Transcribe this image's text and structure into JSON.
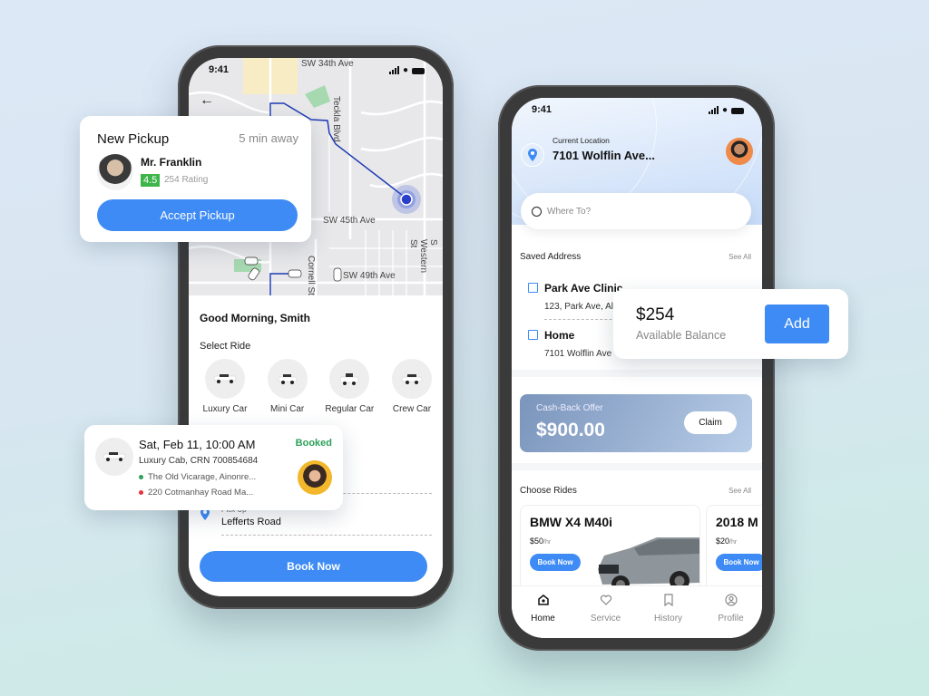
{
  "phone1": {
    "status": {
      "time": "9:41"
    },
    "map": {
      "streets": [
        "SW 34th Ave",
        "Teckla Blvd",
        "SW 45th Ave",
        "Cornell St",
        "SW 49th Ave",
        "S Western St"
      ],
      "back_icon": "arrow-left-icon"
    },
    "greeting": "Good Morning, Smith",
    "select_ride_label": "Select Ride",
    "rides": [
      {
        "label": "Luxury Car",
        "icon": "car-icon"
      },
      {
        "label": "Mini Car",
        "icon": "car-icon"
      },
      {
        "label": "Regular Car",
        "icon": "car-icon"
      },
      {
        "label": "Crew Car",
        "icon": "car-icon"
      }
    ],
    "pickup": {
      "label": "Pick Up",
      "value": "Lefferts Road"
    },
    "book_now_label": "Book Now"
  },
  "pickup_card": {
    "title": "New Pickup",
    "eta": "5 min away",
    "name": "Mr. Franklin",
    "rating": "4.5",
    "rating_count": "254 Rating",
    "accept_label": "Accept Pickup"
  },
  "booking_card": {
    "datetime": "Sat, Feb 11, 10:00 AM",
    "cab": "Luxury Cab, CRN 700854684",
    "from": "The Old Vicarage, Ainonre...",
    "to": "220 Cotmanhay Road Ma...",
    "status": "Booked",
    "colors": {
      "from_dot": "#2ea05a",
      "to_dot": "#e8333a",
      "status": "#2ea05a"
    }
  },
  "phone2": {
    "status": {
      "time": "9:41"
    },
    "current_location_label": "Current Location",
    "current_location": "7101 Wolflin Ave...",
    "search_placeholder": "Where To?",
    "saved_address_title": "Saved Address",
    "see_all": "See All",
    "addresses": [
      {
        "name": "Park Ave Clinic",
        "address": "123, Park Ave, Al"
      },
      {
        "name": "Home",
        "address": "7101 Wolflin Ave"
      }
    ],
    "cashback": {
      "label": "Cash-Back Offer",
      "amount": "$900.00",
      "claim_label": "Claim"
    },
    "choose_rides_title": "Choose Rides",
    "cars": [
      {
        "name": "BMW X4 M40i",
        "price": "$50",
        "unit": "/hr",
        "book_label": "Book Now"
      },
      {
        "name": "2018 M",
        "price": "$20",
        "unit": "/hr",
        "book_label": "Book Now"
      }
    ],
    "tabs": [
      {
        "label": "Home",
        "icon": "home-icon",
        "active": true
      },
      {
        "label": "Service",
        "icon": "heart-icon",
        "active": false
      },
      {
        "label": "History",
        "icon": "bookmark-icon",
        "active": false
      },
      {
        "label": "Profile",
        "icon": "profile-icon",
        "active": false
      }
    ]
  },
  "balance_card": {
    "amount": "$254",
    "label": "Available Balance",
    "add_label": "Add"
  },
  "colors": {
    "accent": "#3e8bf5",
    "route": "#1f3bb3",
    "rating_badge": "#3db54a"
  }
}
